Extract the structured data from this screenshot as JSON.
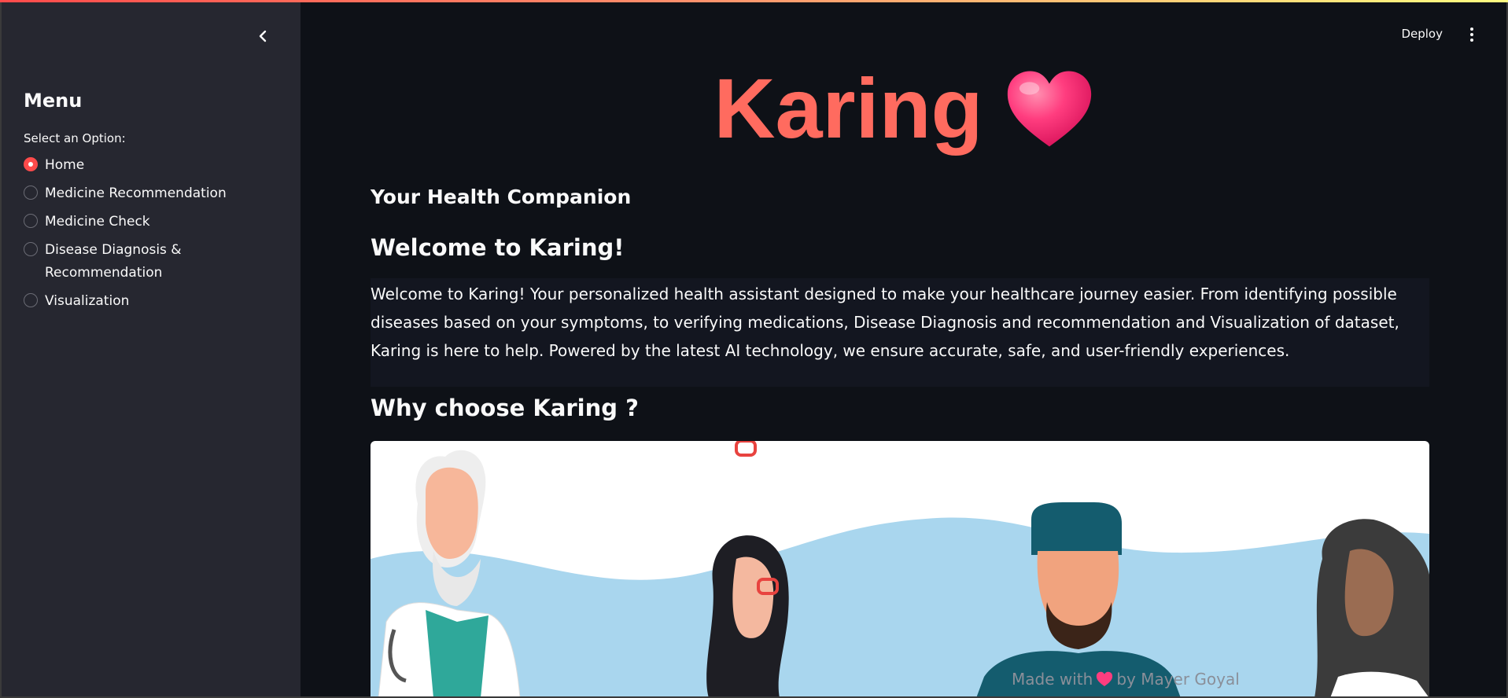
{
  "colors": {
    "accent": "#ff4b4b",
    "hero_text": "#ff6b5f",
    "background": "#0e1117",
    "sidebar": "#262730",
    "heart": "#ff3d7f"
  },
  "icons": {
    "collapse": "chevron-left-icon",
    "more": "kebab-menu-icon",
    "hero": "heart-icon",
    "footer": "heart-icon"
  },
  "sidebar": {
    "title": "Menu",
    "select_label": "Select an Option:",
    "options": [
      {
        "label": "Home",
        "selected": true
      },
      {
        "label": "Medicine Recommendation",
        "selected": false
      },
      {
        "label": "Medicine Check",
        "selected": false
      },
      {
        "label": "Disease Diagnosis & Recommendation",
        "selected": false
      },
      {
        "label": "Visualization",
        "selected": false
      }
    ]
  },
  "header": {
    "deploy_label": "Deploy"
  },
  "main": {
    "hero_title": "Karing",
    "subtitle": "Your Health Companion",
    "welcome_title": "Welcome to Karing!",
    "welcome_text": "Welcome to Karing! Your personalized health assistant designed to make your healthcare journey easier. From identifying possible diseases based on your symptoms, to verifying medications, Disease Diagnosis and recommendation and Visualization of dataset, Karing is here to help. Powered by the latest AI technology, we ensure accurate, safe, and user-friendly experiences.",
    "why_title": "Why choose Karing ?"
  },
  "footer": {
    "prefix": "Made with",
    "suffix": "by Mayer Goyal"
  }
}
